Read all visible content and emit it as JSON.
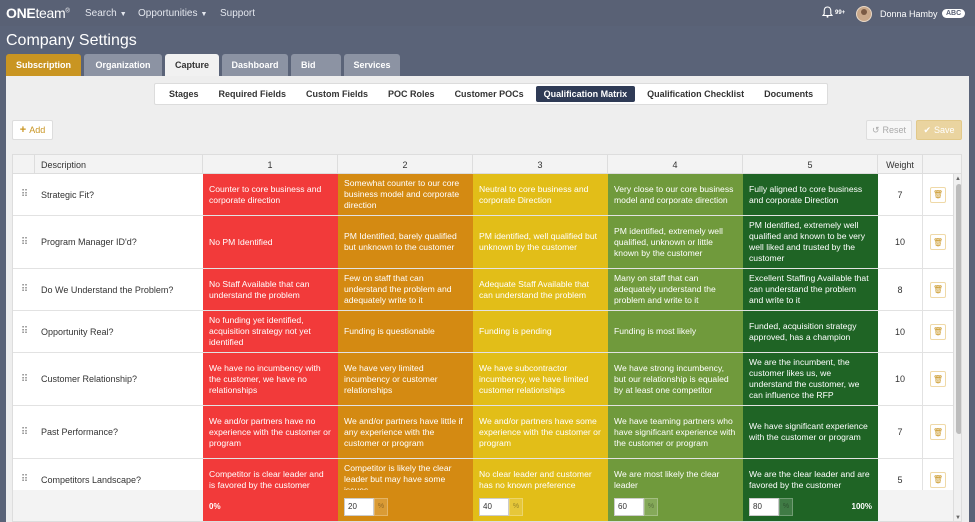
{
  "nav": {
    "logo_bold": "ONE",
    "logo_rest": "team",
    "logo_mark": "®",
    "links": [
      "Search",
      "Opportunities",
      "Support"
    ],
    "notification_count": "99+",
    "user_name": "Donna Hamby",
    "user_badge": "ABC"
  },
  "page_title": "Company Settings",
  "tabs": [
    "Subscription",
    "Organization",
    "Capture",
    "Dashboard",
    "Bid",
    "Services"
  ],
  "subtabs": [
    "Stages",
    "Required Fields",
    "Custom Fields",
    "POC Roles",
    "Customer POCs",
    "Qualification Matrix",
    "Qualification Checklist",
    "Documents"
  ],
  "toolbar": {
    "add_label": "Add",
    "reset_label": "Reset",
    "save_label": "Save"
  },
  "table": {
    "headers": {
      "description": "Description",
      "levels": [
        "1",
        "2",
        "3",
        "4",
        "5"
      ],
      "weight": "Weight"
    },
    "rows": [
      {
        "description": "Strategic Fit?",
        "levels": [
          "Counter to core business and corporate direction",
          "Somewhat counter to our core business model and corporate direction",
          "Neutral to core business and corporate Direction",
          "Very close to our core business model and corporate direction",
          "Fully aligned to core business and corporate Direction"
        ],
        "weight": "7"
      },
      {
        "description": "Program Manager ID'd?",
        "levels": [
          "No PM Identified",
          "PM Identified, barely qualified but unknown to the customer",
          "PM identified, well qualified but unknown by the customer",
          "PM identified, extremely well qualified, unknown or little known by the customer",
          "PM Identified, extremely well qualified and known to be very well liked and trusted by the customer"
        ],
        "weight": "10"
      },
      {
        "description": "Do We Understand the Problem?",
        "levels": [
          "No Staff Available that can understand the problem",
          "Few on staff that can understand the problem and adequately write to it",
          "Adequate Staff Available that can understand the problem",
          "Many on staff that can adequately understand the problem and write to it",
          "Excellent Staffing Available that can understand the problem and write to it"
        ],
        "weight": "8"
      },
      {
        "description": "Opportunity Real?",
        "levels": [
          "No funding yet identified, acquisition strategy not yet identified",
          "Funding is questionable",
          "Funding is pending",
          "Funding is most likely",
          "Funded, acquisition strategy approved, has a champion"
        ],
        "weight": "10"
      },
      {
        "description": "Customer Relationship?",
        "levels": [
          "We have no incumbency with the customer, we have no relationships",
          "We have very limited incumbency or customer relationships",
          "We have subcontractor incumbency, we have limited customer relationships",
          "We have strong incumbency, but our relationship is equaled by at least one competitor",
          "We are the incumbent, the customer likes us, we understand the customer, we can influence the RFP"
        ],
        "weight": "10"
      },
      {
        "description": "Past Performance?",
        "levels": [
          "We and/or partners have no experience with the customer or program",
          "We and/or partners have little if any experience with the customer or program",
          "We and/or partners have some experience with the customer or program",
          "We have teaming partners who have significant experience with the customer or program",
          "We have significant experience with the customer or program"
        ],
        "weight": "7"
      },
      {
        "description": "Competitors Landscape?",
        "levels": [
          "Competitor is clear leader and is favored by the customer",
          "Competitor is likely the clear leader but may have some issues",
          "No clear leader and customer has no known preference",
          "We are most likely the clear leader",
          "We are the clear leader and are favored by the customer"
        ],
        "weight": "5"
      }
    ],
    "footer": {
      "level1_pct": "0%",
      "level2_value": "20",
      "level3_value": "40",
      "level4_value": "60",
      "level5_value": "80",
      "level5_pct": "100%",
      "suffix": "%"
    }
  },
  "colors": {
    "level1": "#f23a3a",
    "level2": "#d48a12",
    "level3": "#e2be18",
    "level4": "#709a3c",
    "level5": "#1f6425",
    "accent": "#c99522"
  }
}
